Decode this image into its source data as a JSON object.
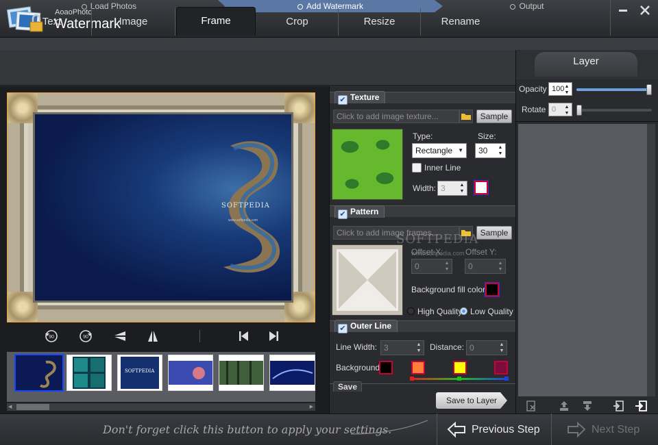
{
  "app": {
    "vendor": "AoaoPhoto",
    "name": "Watermark"
  },
  "window": {
    "minimize_icon": "minimize-icon",
    "close_icon": "close-icon"
  },
  "steps": [
    {
      "label": "Load Photos"
    },
    {
      "label": "Add Watermark",
      "active": true
    },
    {
      "label": "Output"
    }
  ],
  "tabs": [
    {
      "label": "Text"
    },
    {
      "label": "Image"
    },
    {
      "label": "Frame",
      "active": true
    },
    {
      "label": "Crop"
    },
    {
      "label": "Resize"
    },
    {
      "label": "Rename"
    }
  ],
  "preview": {
    "watermark_text": "SOFTPEDIA",
    "watermark_sub": "www.softpedia.com"
  },
  "thumbnails": [
    {
      "name": "thumb-1",
      "selected": true
    },
    {
      "name": "thumb-2"
    },
    {
      "name": "thumb-3",
      "caption": "SOFTPEDIA"
    },
    {
      "name": "thumb-4"
    },
    {
      "name": "thumb-5"
    },
    {
      "name": "thumb-6"
    }
  ],
  "texture": {
    "title": "Texture",
    "placeholder": "Click to add image texture...",
    "sample_label": "Sample",
    "type_label": "Type:",
    "type_value": "Rectangle",
    "size_label": "Size:",
    "size_value": "30",
    "inner_line_label": "Inner Line",
    "width_label": "Width:",
    "width_value": "3"
  },
  "pattern": {
    "title": "Pattern",
    "placeholder": "Click to add image frames...",
    "sample_label": "Sample",
    "offset_x_label": "Offset X:",
    "offset_x_value": "0",
    "offset_y_label": "Offset Y:",
    "offset_y_value": "0",
    "bg_fill_label": "Background fill color:",
    "high_quality_label": "High Quality",
    "low_quality_label": "Low Quality",
    "watermark_overlay": "SOFTPEDIA",
    "watermark_overlay_sub": "www.softpedia.com"
  },
  "outer_line": {
    "title": "Outer Line",
    "line_width_label": "Line Width:",
    "line_width_value": "3",
    "distance_label": "Distance:",
    "distance_value": "0",
    "background_label": "Background",
    "colors": [
      "#000000",
      "#ff7f3a",
      "#ffff00",
      "#7a0d3d"
    ]
  },
  "save": {
    "label": "Save",
    "button_label": "Save to Layer"
  },
  "layer": {
    "title": "Layer",
    "opacity_label": "Opacity",
    "opacity_value": "100",
    "rotate_label": "Rotate",
    "rotate_value": "0",
    "opacity_level": 1.0,
    "rotate_level": 0.0
  },
  "footer": {
    "hint": "Don't forget click this button to apply your settings.",
    "prev_label": "Previous Step",
    "next_label": "Next Step"
  }
}
